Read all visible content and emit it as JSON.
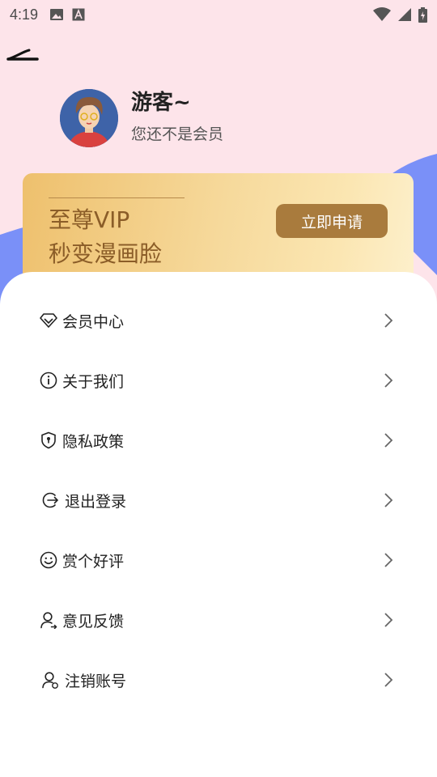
{
  "status_bar": {
    "time": "4:19",
    "left_icons": [
      "image-icon",
      "font-icon"
    ],
    "right_icons": [
      "wifi-icon",
      "signal-icon",
      "battery-icon"
    ]
  },
  "header": {
    "back_icon": "back-arrow-icon"
  },
  "profile": {
    "username": "游客~",
    "member_status": "您还不是会员"
  },
  "vip_card": {
    "title": "至尊VIP",
    "subtitle": "秒变漫画脸",
    "apply_label": "立即申请"
  },
  "menu": [
    {
      "label": "会员中心",
      "icon": "diamond-icon"
    },
    {
      "label": "关于我们",
      "icon": "info-icon"
    },
    {
      "label": "隐私政策",
      "icon": "shield-icon"
    },
    {
      "label": "退出登录",
      "icon": "logout-icon"
    },
    {
      "label": "赏个好评",
      "icon": "smile-icon"
    },
    {
      "label": "意见反馈",
      "icon": "user-feedback-icon"
    },
    {
      "label": "注销账号",
      "icon": "user-delete-icon"
    }
  ],
  "colors": {
    "page_pink": "#fde4ea",
    "wave_blue": "#7a90f8",
    "vip_gold_dark": "#8b5d28",
    "apply_button": "#a97b3d"
  }
}
